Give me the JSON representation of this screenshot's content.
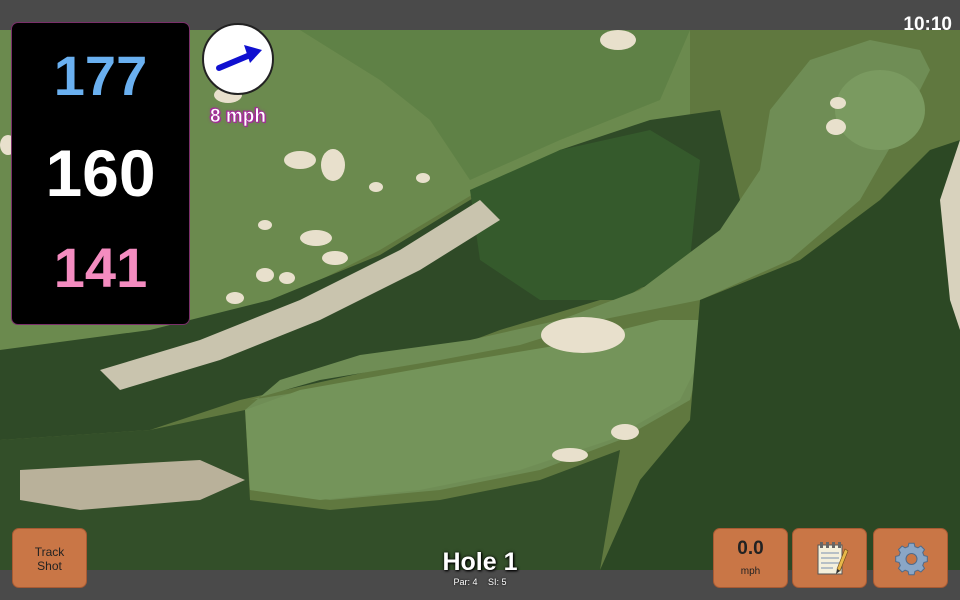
{
  "status": {
    "time": "10:10"
  },
  "yardage": {
    "back": "177",
    "center": "160",
    "front": "141"
  },
  "wind": {
    "speed": "8 mph",
    "icon": "wind-direction-arrow-icon"
  },
  "track_shot": {
    "line1": "Track",
    "line2": "Shot"
  },
  "hole": {
    "title": "Hole 1",
    "par": "Par: 4",
    "si": "SI: 5"
  },
  "speed": {
    "value": "0.0",
    "unit": "mph"
  },
  "icons": {
    "notes": "notepad-icon",
    "settings": "gear-icon"
  },
  "colors": {
    "back": "#6ab0f0",
    "center": "#ffffff",
    "front": "#f48cc0",
    "button": "#c97646",
    "wind_label": "#a42a9a"
  }
}
